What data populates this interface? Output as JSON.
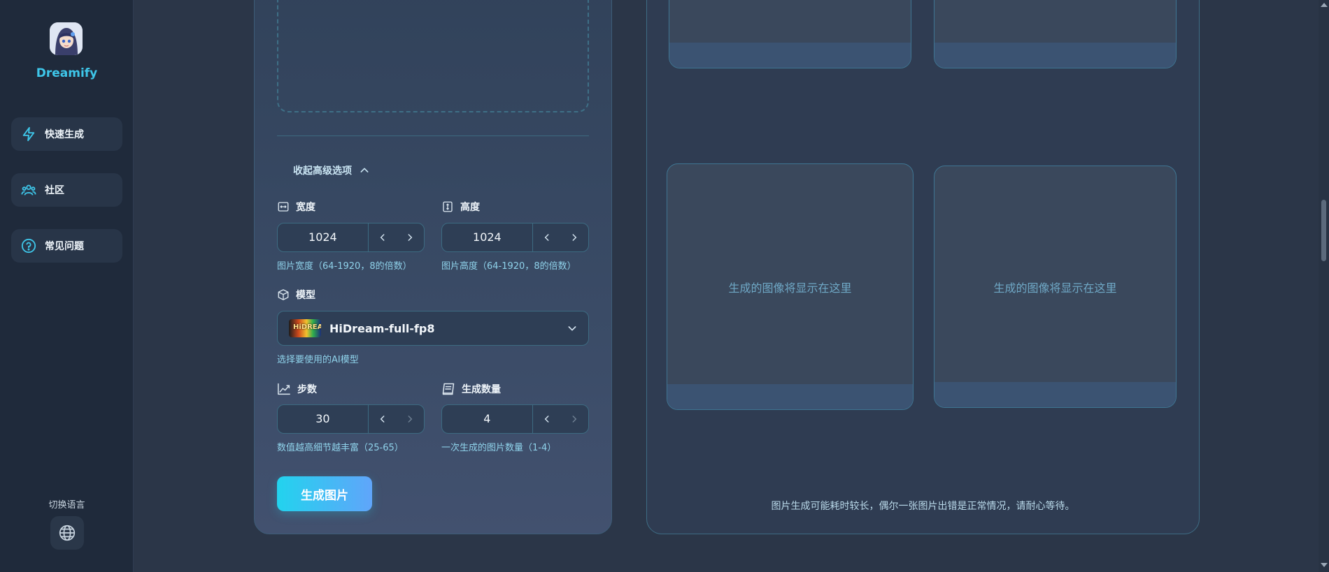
{
  "brand": {
    "name": "Dreamify"
  },
  "sidebar": {
    "items": [
      {
        "label": "快速生成",
        "icon": "lightning-icon"
      },
      {
        "label": "社区",
        "icon": "users-icon"
      },
      {
        "label": "常见问题",
        "icon": "question-icon"
      }
    ],
    "language_label": "切换语言",
    "language_icon": "globe-icon"
  },
  "form": {
    "advanced_toggle_label": "收起高级选项",
    "width": {
      "label": "宽度",
      "value": "1024",
      "hint": "图片宽度（64-1920，8的倍数）"
    },
    "height": {
      "label": "高度",
      "value": "1024",
      "hint": "图片高度（64-1920，8的倍数）"
    },
    "model": {
      "label": "模型",
      "selected": "HiDream-full-fp8",
      "thumb_text": "HiDREAM",
      "hint": "选择要使用的AI模型"
    },
    "steps": {
      "label": "步数",
      "value": "30",
      "hint": "数值越高细节越丰富（25-65）"
    },
    "count": {
      "label": "生成数量",
      "value": "4",
      "hint": "一次生成的图片数量（1-4）"
    },
    "generate_label": "生成图片"
  },
  "results": {
    "placeholders": [
      "",
      "",
      "生成的图像将显示在这里",
      "生成的图像将显示在这里"
    ],
    "footer_note": "图片生成可能耗时较长，偶尔一张图片出错是正常情况，请耐心等待。"
  },
  "colors": {
    "accent": "#3ec6e9",
    "button_gradient_start": "#22d3ee",
    "button_gradient_end": "#60a5fa",
    "hint_text": "#8fd2ea"
  }
}
